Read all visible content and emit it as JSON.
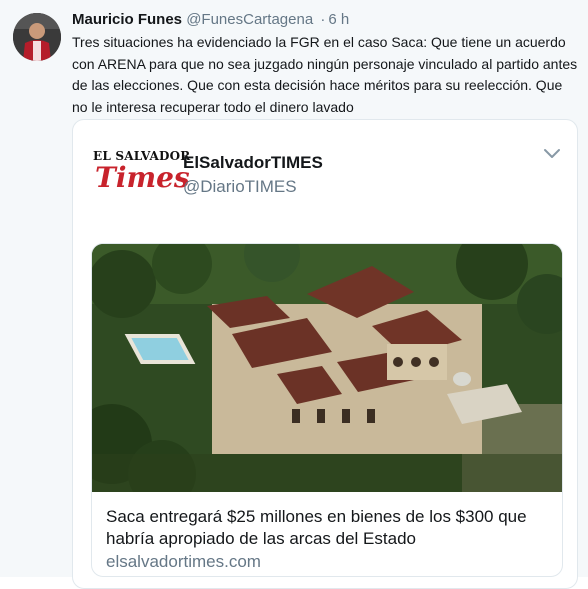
{
  "tweet": {
    "author_name": "Mauricio Funes",
    "author_handle": "@FunesCartagena",
    "separator": "·",
    "time": "6 h",
    "text": "Tres situaciones ha evidenciado la FGR en el caso Saca: Que tiene un acuerdo con ARENA para que no sea juzgado ningún personaje vinculado al partido antes de las elecciones. Que con esta decisión hace méritos para su reelección. Que no le interesa recuperar todo el dinero lavado"
  },
  "card": {
    "logo_top": "EL SALVADOR",
    "logo_bottom": "Times",
    "name": "ElSalvadorTIMES",
    "handle": "@DiarioTIMES",
    "menu_icon": "chevron-down-icon",
    "link": {
      "title": "Saca entregará $25 millones en bienes de los $300 que habría apropiado de las arcas del Estado",
      "domain": "elsalvadortimes.com"
    }
  },
  "colors": {
    "text_primary": "#14171a",
    "text_secondary": "#657786",
    "background": "#f5f8fa",
    "card_border": "#e1e8ed",
    "logo_red": "#c8232c"
  }
}
